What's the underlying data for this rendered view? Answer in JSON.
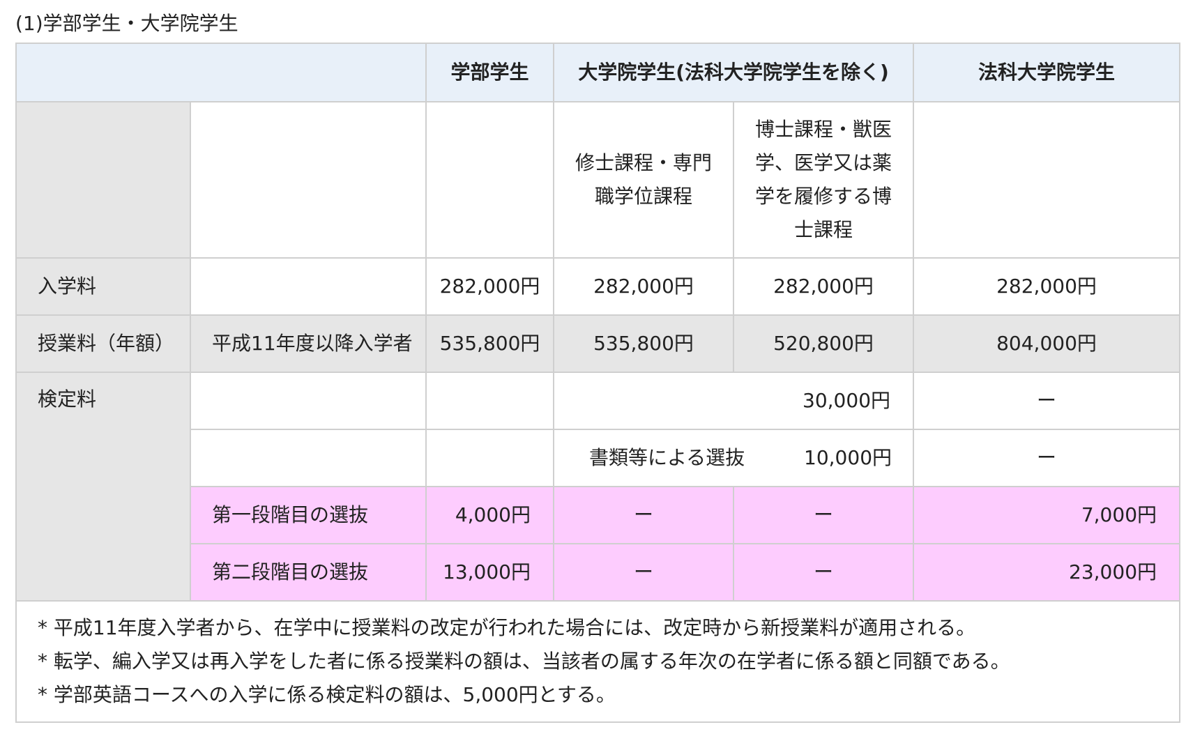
{
  "caption": "(1)学部学生・大学院学生",
  "header": {
    "col_undergrad": "学部学生",
    "col_grad": "大学院学生(法科大学院学生を除く)",
    "col_law": "法科大学院学生"
  },
  "subheader": {
    "masters_line1": "修士課程・専門",
    "masters_line2": "職学位課程",
    "doctoral_line1": "博士課程・獣医",
    "doctoral_line2": "学、医学又は薬",
    "doctoral_line3": "学を履修する博",
    "doctoral_line4": "士課程"
  },
  "rows": {
    "admission": {
      "label": "入学料",
      "undergrad": "282,000円",
      "masters": "282,000円",
      "doctoral": "282,000円",
      "law": "282,000円"
    },
    "tuition": {
      "label": "授業料（年額）",
      "sub": "平成11年度以降入学者",
      "undergrad": "535,800円",
      "masters": "535,800円",
      "doctoral": "520,800円",
      "law": "804,000円"
    },
    "exam": {
      "label": "検定料",
      "general_grad": "30,000円",
      "general_law": "ー",
      "docs_label": "書類等による選抜",
      "docs_grad": "10,000円",
      "docs_law": "ー",
      "stage1": {
        "label": "第一段階目の選抜",
        "undergrad": "4,000円",
        "masters": "ー",
        "doctoral": "ー",
        "law": "7,000円"
      },
      "stage2": {
        "label": "第二段階目の選抜",
        "undergrad": "13,000円",
        "masters": "ー",
        "doctoral": "ー",
        "law": "23,000円"
      }
    }
  },
  "notes": [
    "* 平成11年度入学者から、在学中に授業料の改定が行われた場合には、改定時から新授業料が適用される。",
    "* 転学、編入学又は再入学をした者に係る授業料の額は、当該者の属する年次の在学者に係る額と同額である。",
    "* 学部英語コースへの入学に係る検定料の額は、5,000円とする。"
  ],
  "colors": {
    "header_bg": "#e8f0f9",
    "grey_bg": "#e6e6e6",
    "pink_bg": "#fdccfe",
    "border": "#cfcfcf"
  }
}
